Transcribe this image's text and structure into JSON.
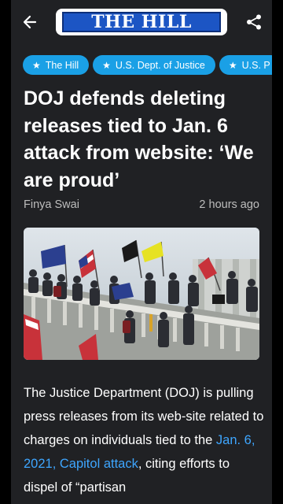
{
  "header": {
    "back_icon": "arrow-left-icon",
    "logo_text": "THE HILL",
    "share_icon": "share-icon"
  },
  "tags": [
    {
      "label": "The Hill",
      "icon": "star-icon"
    },
    {
      "label": "U.S. Dept. of Justice",
      "icon": "star-icon"
    },
    {
      "label": "U.S. P",
      "icon": "star-icon"
    }
  ],
  "article": {
    "title": "DOJ defends deleting releases tied to Jan. 6 attack from website: ‘We are proud’",
    "author": "Finya Swai",
    "time": "2 hours ago",
    "body_before_link": "The Justice Department (DOJ) is pulling press releases from its web-site related to charges on individuals tied to the ",
    "body_link": "Jan. 6, 2021, Capitol attack",
    "body_after_link": ", citing efforts to dispel of “partisan"
  },
  "colors": {
    "background": "#202124",
    "tag": "#1aa0e6",
    "link": "#3ea6ff",
    "logo_blue": "#1c55c4"
  }
}
